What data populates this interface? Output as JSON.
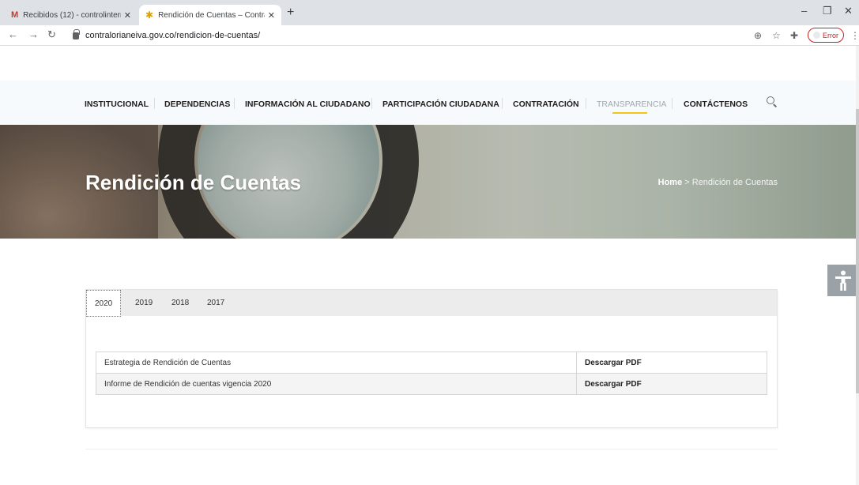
{
  "browser": {
    "tabs": [
      {
        "label": "Recibidos (12) - controlinterno@",
        "icon": "gmail-icon"
      },
      {
        "label": "Rendición de Cuentas – Contralo",
        "icon": "star-icon"
      }
    ],
    "url": "contralorianeiva.gov.co/rendicion-de-cuentas/",
    "profile_status": "Error"
  },
  "nav": {
    "items": [
      "INSTITUCIONAL",
      "DEPENDENCIAS",
      "INFORMACIÓN AL CIUDADANO",
      "PARTICIPACIÓN CIUDADANA",
      "CONTRATACIÓN",
      "TRANSPARENCIA",
      "CONTÁCTENOS"
    ],
    "active_index": 5,
    "accent_color": "#f2c418"
  },
  "hero": {
    "title": "Rendición de Cuentas",
    "breadcrumb_home": "Home",
    "breadcrumb_sep": " > ",
    "breadcrumb_current": "Rendición de Cuentas"
  },
  "years": {
    "tabs": [
      "2020",
      "2019",
      "2018",
      "2017"
    ],
    "active_index": 0
  },
  "documents": [
    {
      "name": "Estrategia de Rendición de Cuentas",
      "action": "Descargar PDF"
    },
    {
      "name": "Informe de Rendición de cuentas vigencia 2020",
      "action": "Descargar PDF"
    }
  ]
}
